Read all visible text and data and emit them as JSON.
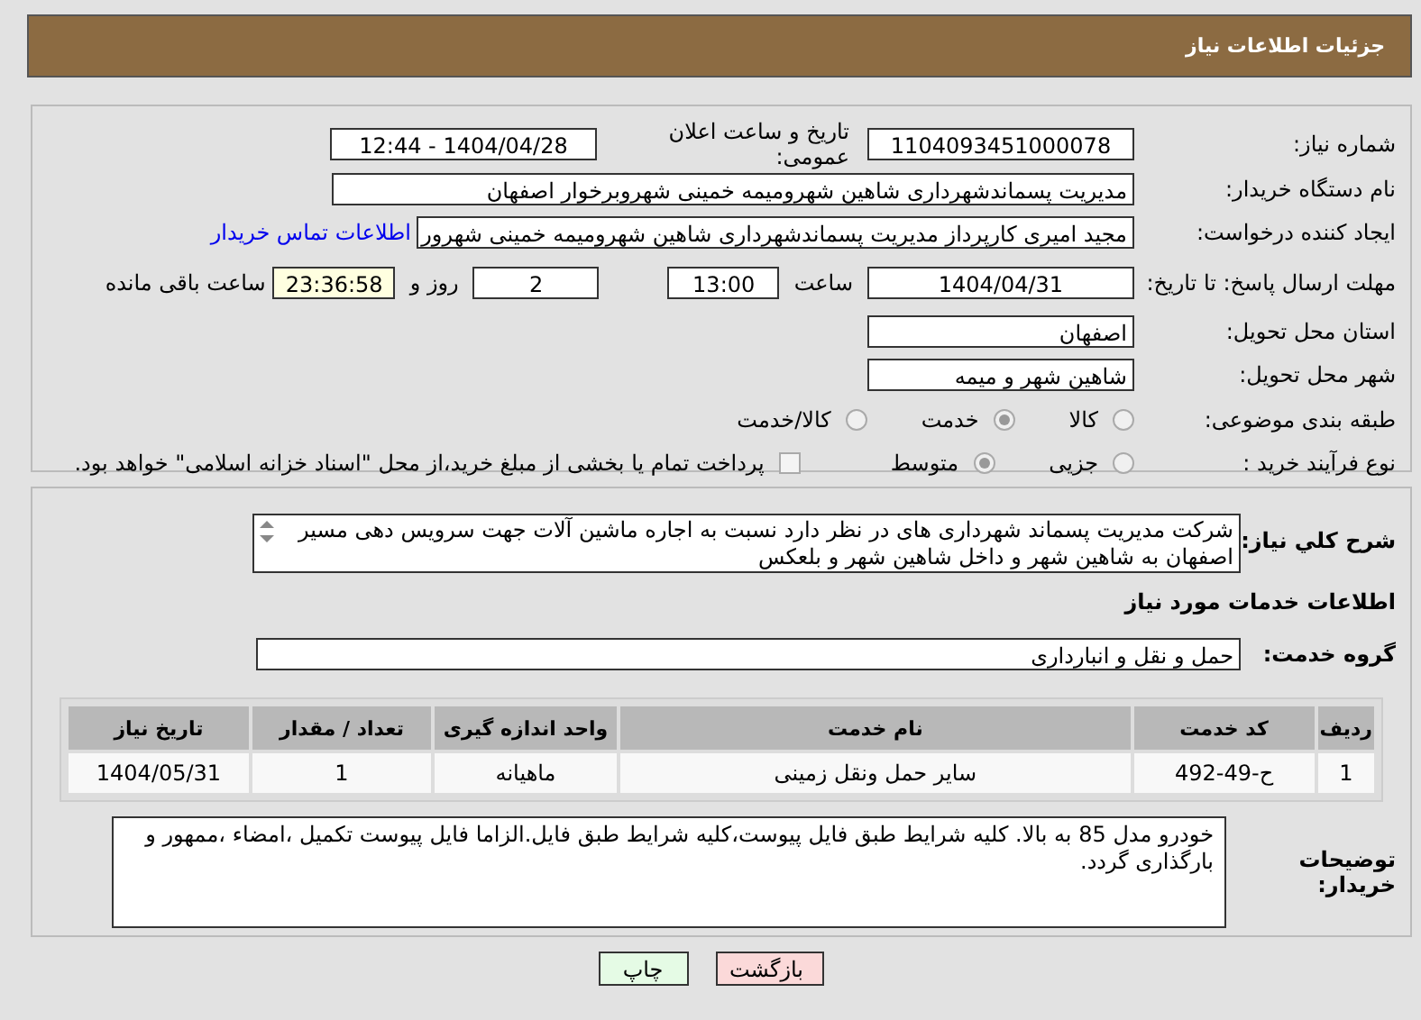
{
  "header": {
    "title": "جزئیات اطلاعات نیاز"
  },
  "need_number": {
    "label": "شماره نیاز:",
    "value": "1104093451000078"
  },
  "announce": {
    "label": "تاریخ و ساعت اعلان عمومی:",
    "value": "1404/04/28 - 12:44"
  },
  "buyer_org": {
    "label": "نام دستگاه خریدار:",
    "value": "مدیریت پسماندشهرداری شاهین شهرومیمه خمینی شهروبرخوار اصفهان"
  },
  "requester": {
    "label": "ایجاد کننده درخواست:",
    "value": "مجید امیری کارپرداز مدیریت پسماندشهرداری شاهین شهرومیمه خمینی شهرور",
    "link": "اطلاعات تماس خریدار"
  },
  "deadline": {
    "label": "مهلت ارسال پاسخ: تا تاریخ:",
    "date": "1404/04/31",
    "time_label": "ساعت",
    "time": "13:00",
    "days": "2",
    "days_label": "روز و",
    "remaining": "23:36:58",
    "remaining_label": "ساعت باقی مانده"
  },
  "province": {
    "label": "استان محل تحویل:",
    "value": "اصفهان"
  },
  "city": {
    "label": "شهر محل تحویل:",
    "value": "شاهین شهر و میمه"
  },
  "category": {
    "label": "طبقه بندی موضوعی:",
    "options": [
      {
        "label": "کالا",
        "selected": false
      },
      {
        "label": "خدمت",
        "selected": true
      },
      {
        "label": "کالا/خدمت",
        "selected": false
      }
    ]
  },
  "purchase_type": {
    "label": "نوع فرآیند خرید :",
    "options": [
      {
        "label": "جزیی",
        "selected": false
      },
      {
        "label": "متوسط",
        "selected": true
      }
    ],
    "treasury": {
      "checked": false,
      "text": "پرداخت تمام یا بخشی از مبلغ خرید،از محل \"اسناد خزانه اسلامی\" خواهد بود."
    }
  },
  "description": {
    "label": "شرح کلي نیاز:",
    "text": "شرکت مدیریت پسماند شهرداری های  در نظر دارد نسبت به اجاره ماشین آلات جهت سرویس دهی مسیر اصفهان به شاهین شهر و داخل شاهین شهر و بلعکس"
  },
  "services_heading": "اطلاعات خدمات مورد نیاز",
  "service_group": {
    "label": "گروه خدمت:",
    "value": "حمل و نقل و انبارداری"
  },
  "table": {
    "columns": [
      "ردیف",
      "کد خدمت",
      "نام خدمت",
      "واحد اندازه گیری",
      "تعداد / مقدار",
      "تاریخ نیاز"
    ],
    "rows": [
      [
        "1",
        "ح-49-492",
        "سایر حمل ونقل زمینی",
        "ماهیانه",
        "1",
        "1404/05/31"
      ]
    ]
  },
  "buyer_notes": {
    "label": "توضیحات خریدار:",
    "text": "خودرو مدل 85 به بالا. کلیه شرایط طبق فایل پیوست،کلیه شرایط طبق فایل.الزاما فایل پیوست تکمیل ،امضاء ،ممهور و بارگذاری گردد."
  },
  "buttons": [
    {
      "label": "بازگشت",
      "kind": "back"
    },
    {
      "label": "چاپ",
      "kind": "print"
    }
  ]
}
